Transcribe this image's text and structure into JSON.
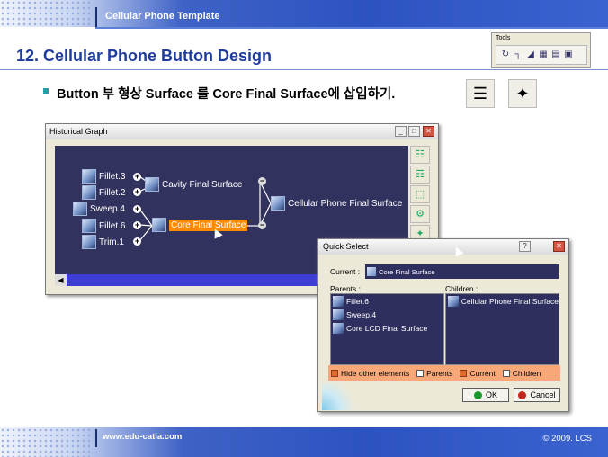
{
  "header": {
    "title": "Cellular Phone Template"
  },
  "tools_toolbar": {
    "label": "Tools",
    "icons": [
      "update-icon",
      "axis-icon",
      "snap-icon",
      "grid-icon",
      "layer-icon",
      "catalog-icon"
    ]
  },
  "slide": {
    "heading": "12. Cellular Phone Button Design",
    "instruction": "Button 부 형상 Surface 를 Core Final Surface에 삽입하기."
  },
  "historical_graph": {
    "window_title": "Historical Graph",
    "nodes": {
      "fillet3": "Fillet.3",
      "fillet2": "Fillet.2",
      "sweep4": "Sweep.4",
      "fillet6": "Fillet.6",
      "trim1": "Trim.1",
      "cavity": "Cavity Final Surface",
      "core": "Core Final Surface",
      "phone": "Cellular Phone Final Surface"
    }
  },
  "quick_select": {
    "window_title": "Quick Select",
    "current_label": "Current :",
    "current_value": "Core Final Surface",
    "parents_label": "Parents :",
    "children_label": "Children :",
    "parents": [
      "Fillet.6",
      "Sweep.4",
      "Core LCD Final Surface"
    ],
    "children": [
      "Cellular Phone Final Surface"
    ],
    "options": [
      {
        "label": "Hide other elements",
        "checked": true
      },
      {
        "label": "Parents",
        "checked": false
      },
      {
        "label": "Current",
        "checked": true
      },
      {
        "label": "Children",
        "checked": false
      }
    ],
    "ok_label": "OK",
    "cancel_label": "Cancel"
  },
  "footer": {
    "url": "www.edu-catia.com",
    "copyright": "© 2009. LCS"
  },
  "colors": {
    "banner": "#2c53c0",
    "heading": "#1f3c9c",
    "graph_bg": "#32325f",
    "selection": "#ff8a00",
    "bullet": "#2d9aa8"
  }
}
